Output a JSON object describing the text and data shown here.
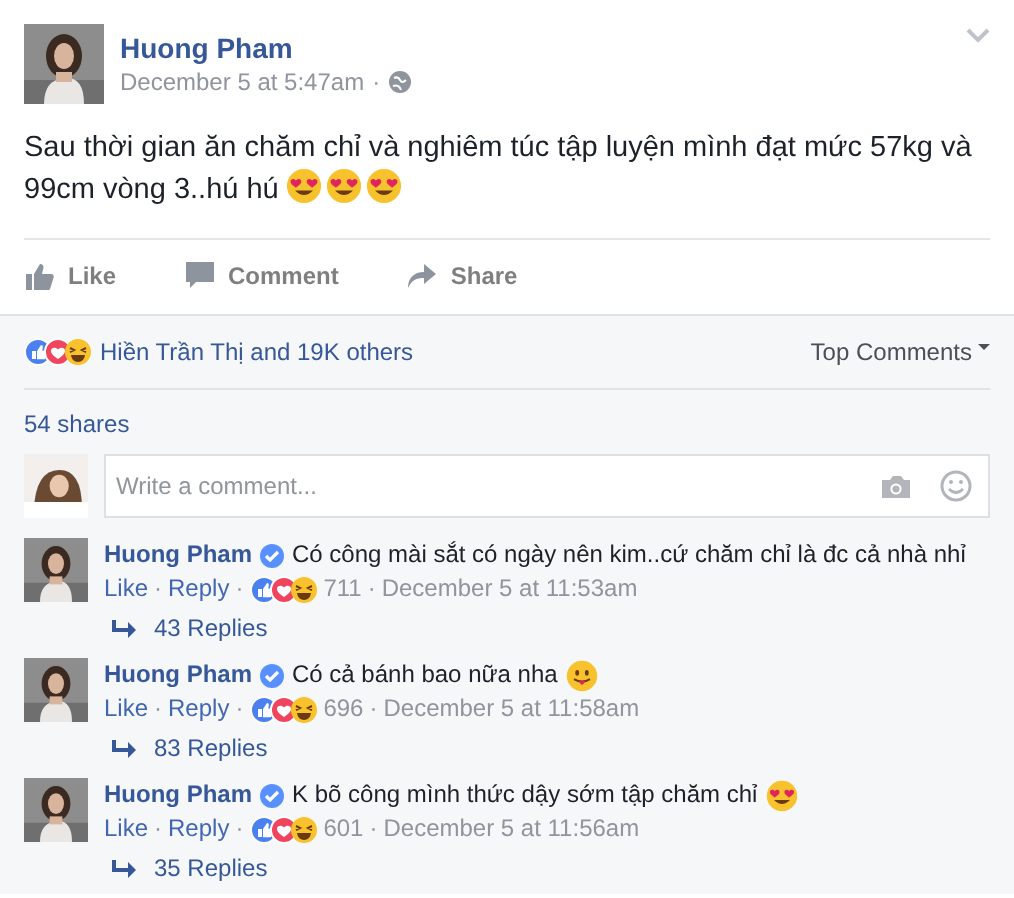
{
  "post": {
    "author": "Huong Pham",
    "time": "December 5 at 5:47am",
    "separator": "·",
    "text_lines": [
      "Sau thời gian ăn chăm chỉ và nghiêm túc tập luyện mình đạt mức 57kg và",
      "99cm vòng 3..hú hú"
    ],
    "emojis": [
      {
        "kind": "heart_eyes"
      },
      {
        "kind": "heart_eyes"
      },
      {
        "kind": "heart_eyes"
      }
    ]
  },
  "actions": [
    {
      "kind": "like",
      "label": "Like"
    },
    {
      "kind": "comment",
      "label": "Comment"
    },
    {
      "kind": "share",
      "label": "Share"
    }
  ],
  "reactions_summary": {
    "text": "Hiền Trần Thị and 19K others",
    "sort": "Top Comments"
  },
  "shares": "54 shares",
  "composer": {
    "placeholder": "Write a comment..."
  },
  "comments": [
    {
      "author": "Huong Pham",
      "text": "Có công mài sắt có ngày nên kim..cứ chăm chỉ là đc cả nhà nhỉ",
      "like": "Like",
      "separators": [
        "·",
        "·",
        "·"
      ],
      "reply": "Reply",
      "count": "711",
      "time": "December 5 at 11:53am",
      "replies": "43 Replies"
    },
    {
      "author": "Huong Pham",
      "text": "Có cả bánh bao nữa nha",
      "emojis": [
        {
          "kind": "tongue"
        }
      ],
      "like": "Like",
      "separators": [
        "·",
        "·",
        "·"
      ],
      "reply": "Reply",
      "count": "696",
      "time": "December 5 at 11:58am",
      "replies": "83 Replies"
    },
    {
      "author": "Huong Pham",
      "text": "K bõ công mình thức dậy sớm tập chăm chỉ",
      "emojis": [
        {
          "kind": "heart_eyes"
        }
      ],
      "like": "Like",
      "separators": [
        "·",
        "·",
        "·"
      ],
      "reply": "Reply",
      "count": "601",
      "time": "December 5 at 11:56am",
      "replies": "35 Replies"
    }
  ]
}
